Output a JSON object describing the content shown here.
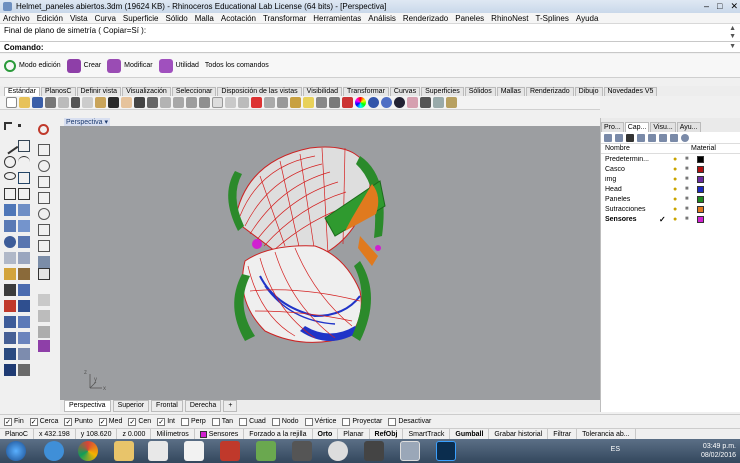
{
  "window": {
    "title": "Helmet_paneles abiertos.3dm (19624 KB) - Rhinoceros Educational Lab License (64 bits) - [Perspectiva]"
  },
  "menu": [
    "Archivo",
    "Edición",
    "Vista",
    "Curva",
    "Superficie",
    "Sólido",
    "Malla",
    "Acotación",
    "Transformar",
    "Herramientas",
    "Análisis",
    "Renderizado",
    "Paneles",
    "RhinoNest",
    "T-Splines",
    "Ayuda"
  ],
  "command": {
    "history": "Final de plano de simetría ( Copiar=Sí ):",
    "prompt": "Comando:",
    "value": ""
  },
  "quickbar": [
    {
      "label": "Modo edición",
      "color": "#2a9a3a"
    },
    {
      "label": "Crear",
      "color": "#8e3fa8"
    },
    {
      "label": "Modificar",
      "color": "#8e3fa8"
    },
    {
      "label": "Utilidad",
      "color": "#8e3fa8"
    },
    {
      "label": "Todos los comandos",
      "color": ""
    }
  ],
  "toolbar_tabs": [
    "Estándar",
    "PlanosC",
    "Definir vista",
    "Visualización",
    "Seleccionar",
    "Disposición de las vistas",
    "Visibilidad",
    "Transformar",
    "Curvas",
    "Superficies",
    "Sólidos",
    "Mallas",
    "Renderizado",
    "Dibujo",
    "Novedades V5"
  ],
  "viewport": {
    "label": "Perspectiva",
    "axis_x": "x",
    "axis_y": "y",
    "axis_z": "z"
  },
  "viewport_tabs": [
    "Perspectiva",
    "Superior",
    "Frontal",
    "Derecha",
    "+"
  ],
  "panel": {
    "tabs": [
      "Pro...",
      "Cap...",
      "Visu...",
      "Ayu..."
    ],
    "col_name": "Nombre",
    "col_material": "Material",
    "layers": [
      {
        "name": "Predetermin...",
        "color": "#000000",
        "current": false
      },
      {
        "name": "Casco",
        "color": "#b01010",
        "current": false
      },
      {
        "name": "img",
        "color": "#6a2aa0",
        "current": false
      },
      {
        "name": "Head",
        "color": "#1b2ac0",
        "current": false
      },
      {
        "name": "Paneles",
        "color": "#1f8a1f",
        "current": false
      },
      {
        "name": "Sutracciones",
        "color": "#e0781e",
        "current": false
      },
      {
        "name": "Sensores",
        "color": "#d020d0",
        "current": true
      }
    ],
    "current_mark": "✓"
  },
  "osnaps": [
    {
      "label": "Fin",
      "checked": true
    },
    {
      "label": "Cerca",
      "checked": true
    },
    {
      "label": "Punto",
      "checked": true
    },
    {
      "label": "Med",
      "checked": true
    },
    {
      "label": "Cen",
      "checked": true
    },
    {
      "label": "Int",
      "checked": true
    },
    {
      "label": "Perp",
      "checked": false
    },
    {
      "label": "Tan",
      "checked": false
    },
    {
      "label": "Cuad",
      "checked": false
    },
    {
      "label": "Nodo",
      "checked": false
    },
    {
      "label": "Vértice",
      "checked": false
    },
    {
      "label": "Proyectar",
      "checked": false
    },
    {
      "label": "Desactivar",
      "checked": false
    }
  ],
  "status": {
    "cplane": "PlanoC",
    "x": "x 432.198",
    "y": "y 108.620",
    "z": "z 0.000",
    "units": "Milímetros",
    "layer": "Sensores",
    "layer_color": "#d020d0",
    "items": [
      "Forzado a la rejilla",
      "Orto",
      "Planar",
      "RefObj",
      "SmartTrack",
      "Gumball",
      "Grabar historial",
      "Filtrar",
      "Tolerancia ab..."
    ]
  },
  "taskbar": {
    "lang": "ES",
    "time": "03:49 p.m.",
    "date": "08/02/2016"
  }
}
